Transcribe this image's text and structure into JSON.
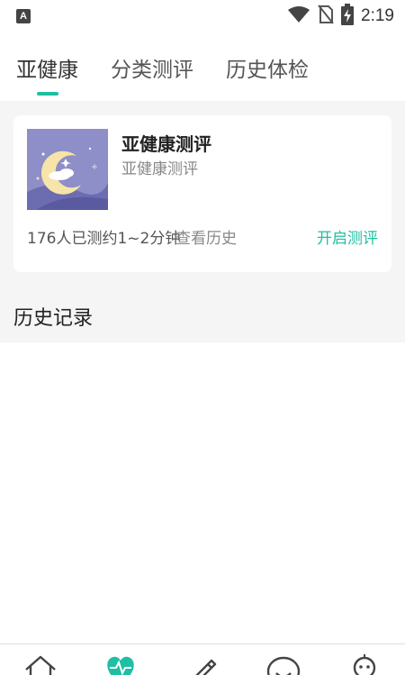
{
  "status_bar": {
    "app_icon": "A",
    "time": "2:19",
    "icons": [
      "wifi-icon",
      "no-sim-icon",
      "battery-charging-icon"
    ]
  },
  "tabs": [
    {
      "label": "亚健康",
      "active": true
    },
    {
      "label": "分类测评",
      "active": false
    },
    {
      "label": "历史体检",
      "active": false
    }
  ],
  "card": {
    "thumbnail_icon": "moon-night-icon",
    "title": "亚健康测评",
    "subtitle": "亚健康测评",
    "meta": "176人已测约1~2分钟",
    "history_link": "查看历史",
    "start_link": "开启测评"
  },
  "section": {
    "title": "历史记录"
  },
  "bottom_nav": {
    "items": [
      "home-icon",
      "heart-pulse-icon",
      "pencil-icon",
      "chat-bubble-icon",
      "robot-icon"
    ],
    "accent": "#1fbfa3"
  },
  "colors": {
    "accent": "#1fbfa3",
    "background": "#f5f5f5"
  }
}
